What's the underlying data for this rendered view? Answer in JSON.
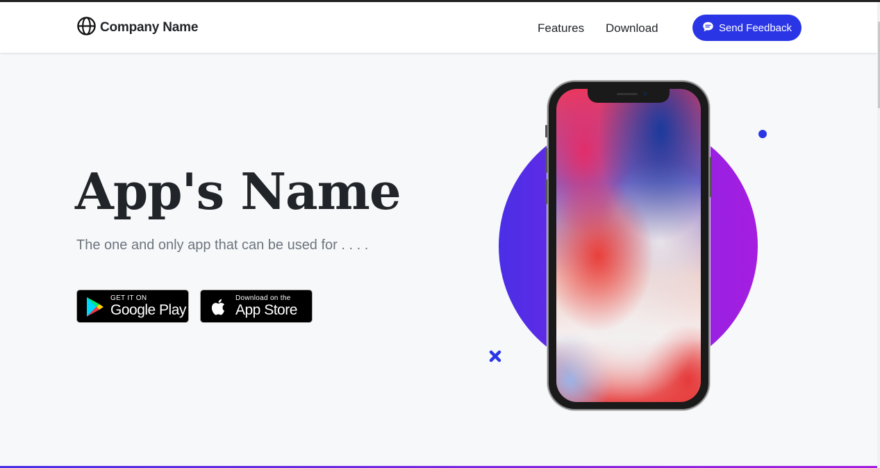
{
  "navbar": {
    "brand_name": "Company Name",
    "brand_icon": "globe-icon",
    "links": [
      {
        "label": "Features"
      },
      {
        "label": "Download"
      }
    ],
    "feedback_button": {
      "label": "Send Feedback",
      "icon": "chat-bubble-icon"
    }
  },
  "hero": {
    "title": "App's Name",
    "subtitle": "The one and only app that can be used for . . . .",
    "google_play": {
      "small": "GET IT ON",
      "big": "Google Play",
      "icon": "google-play-icon"
    },
    "app_store": {
      "small": "Download on the",
      "big": "App Store",
      "icon": "apple-icon"
    }
  },
  "colors": {
    "accent": "#2a36e6",
    "circle_start": "#4a2fe6",
    "circle_end": "#a51ee0",
    "background": "#f7f8fa"
  }
}
